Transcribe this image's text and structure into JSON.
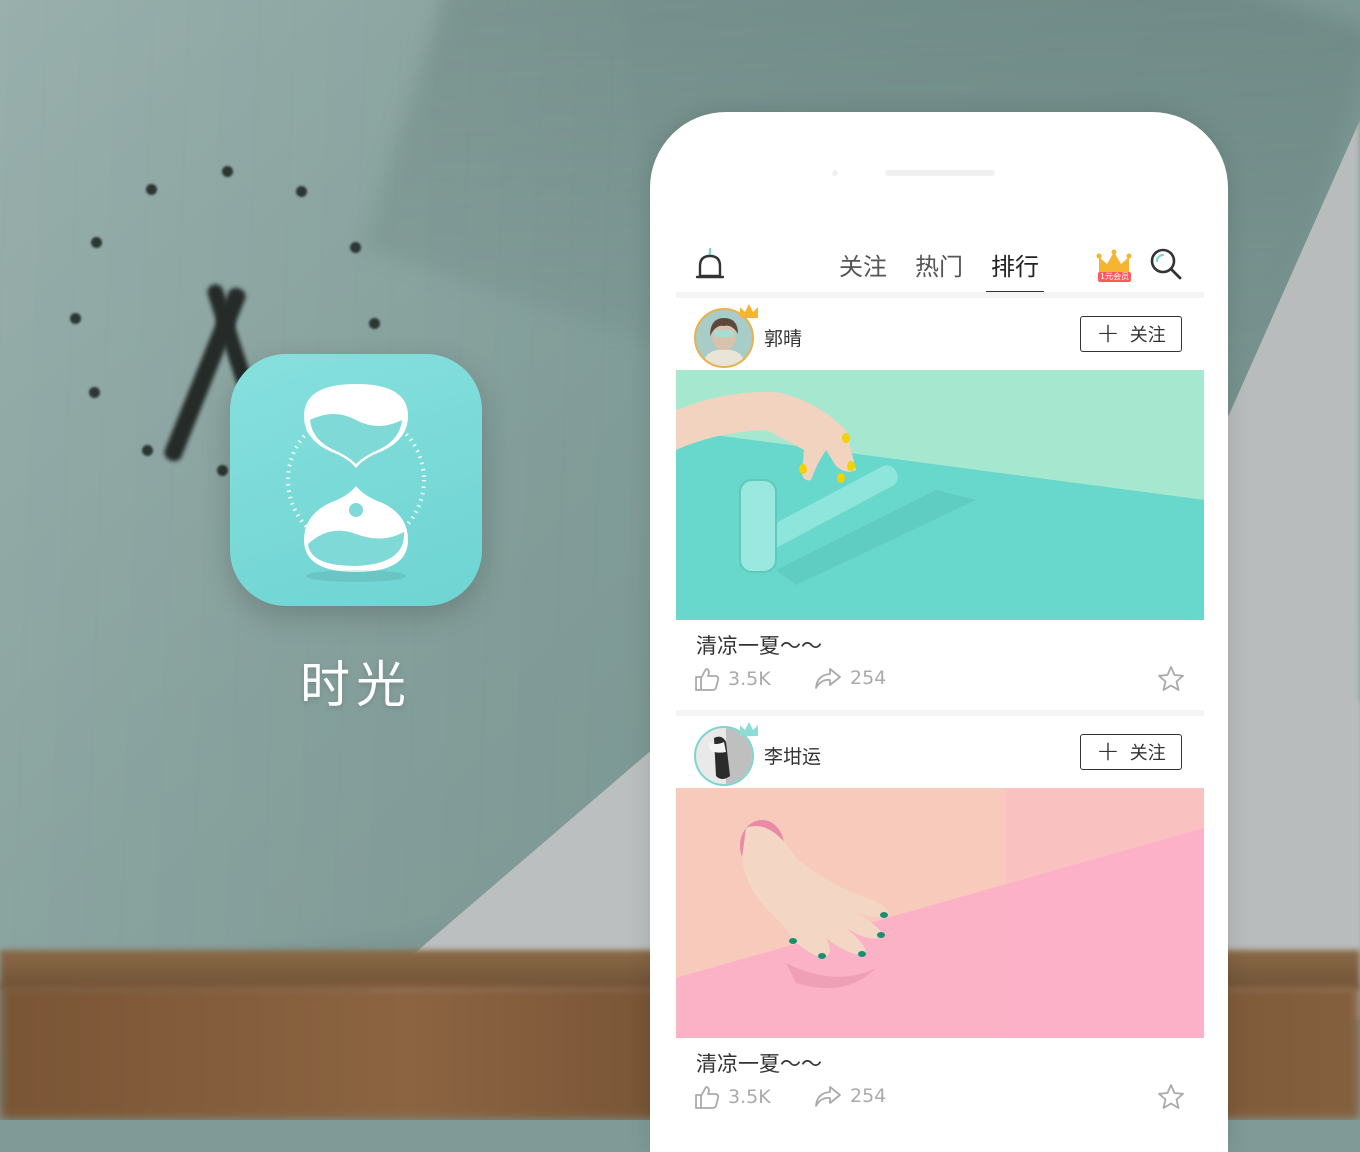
{
  "app": {
    "name": "时光"
  },
  "header": {
    "tabs": [
      {
        "label": "关注",
        "active": false
      },
      {
        "label": "热门",
        "active": false
      },
      {
        "label": "排行",
        "active": true
      }
    ],
    "vip_badge": "1元会员",
    "icons": [
      "bell-icon",
      "crown-icon",
      "search-icon"
    ]
  },
  "posts": [
    {
      "username": "郭晴",
      "follow_label": "关注",
      "caption": "清凉一夏～～",
      "likes": "3.5K",
      "shares": "254",
      "photo_theme": "mint"
    },
    {
      "username": "李坩运",
      "follow_label": "关注",
      "caption": "清凉一夏～～",
      "likes": "3.5K",
      "shares": "254",
      "photo_theme": "pink"
    }
  ],
  "colors": {
    "brand": "#7ddad6",
    "vip_badge": "#ff5a5a",
    "crown": "#f5b531",
    "stat_text": "#aaaaaa"
  }
}
